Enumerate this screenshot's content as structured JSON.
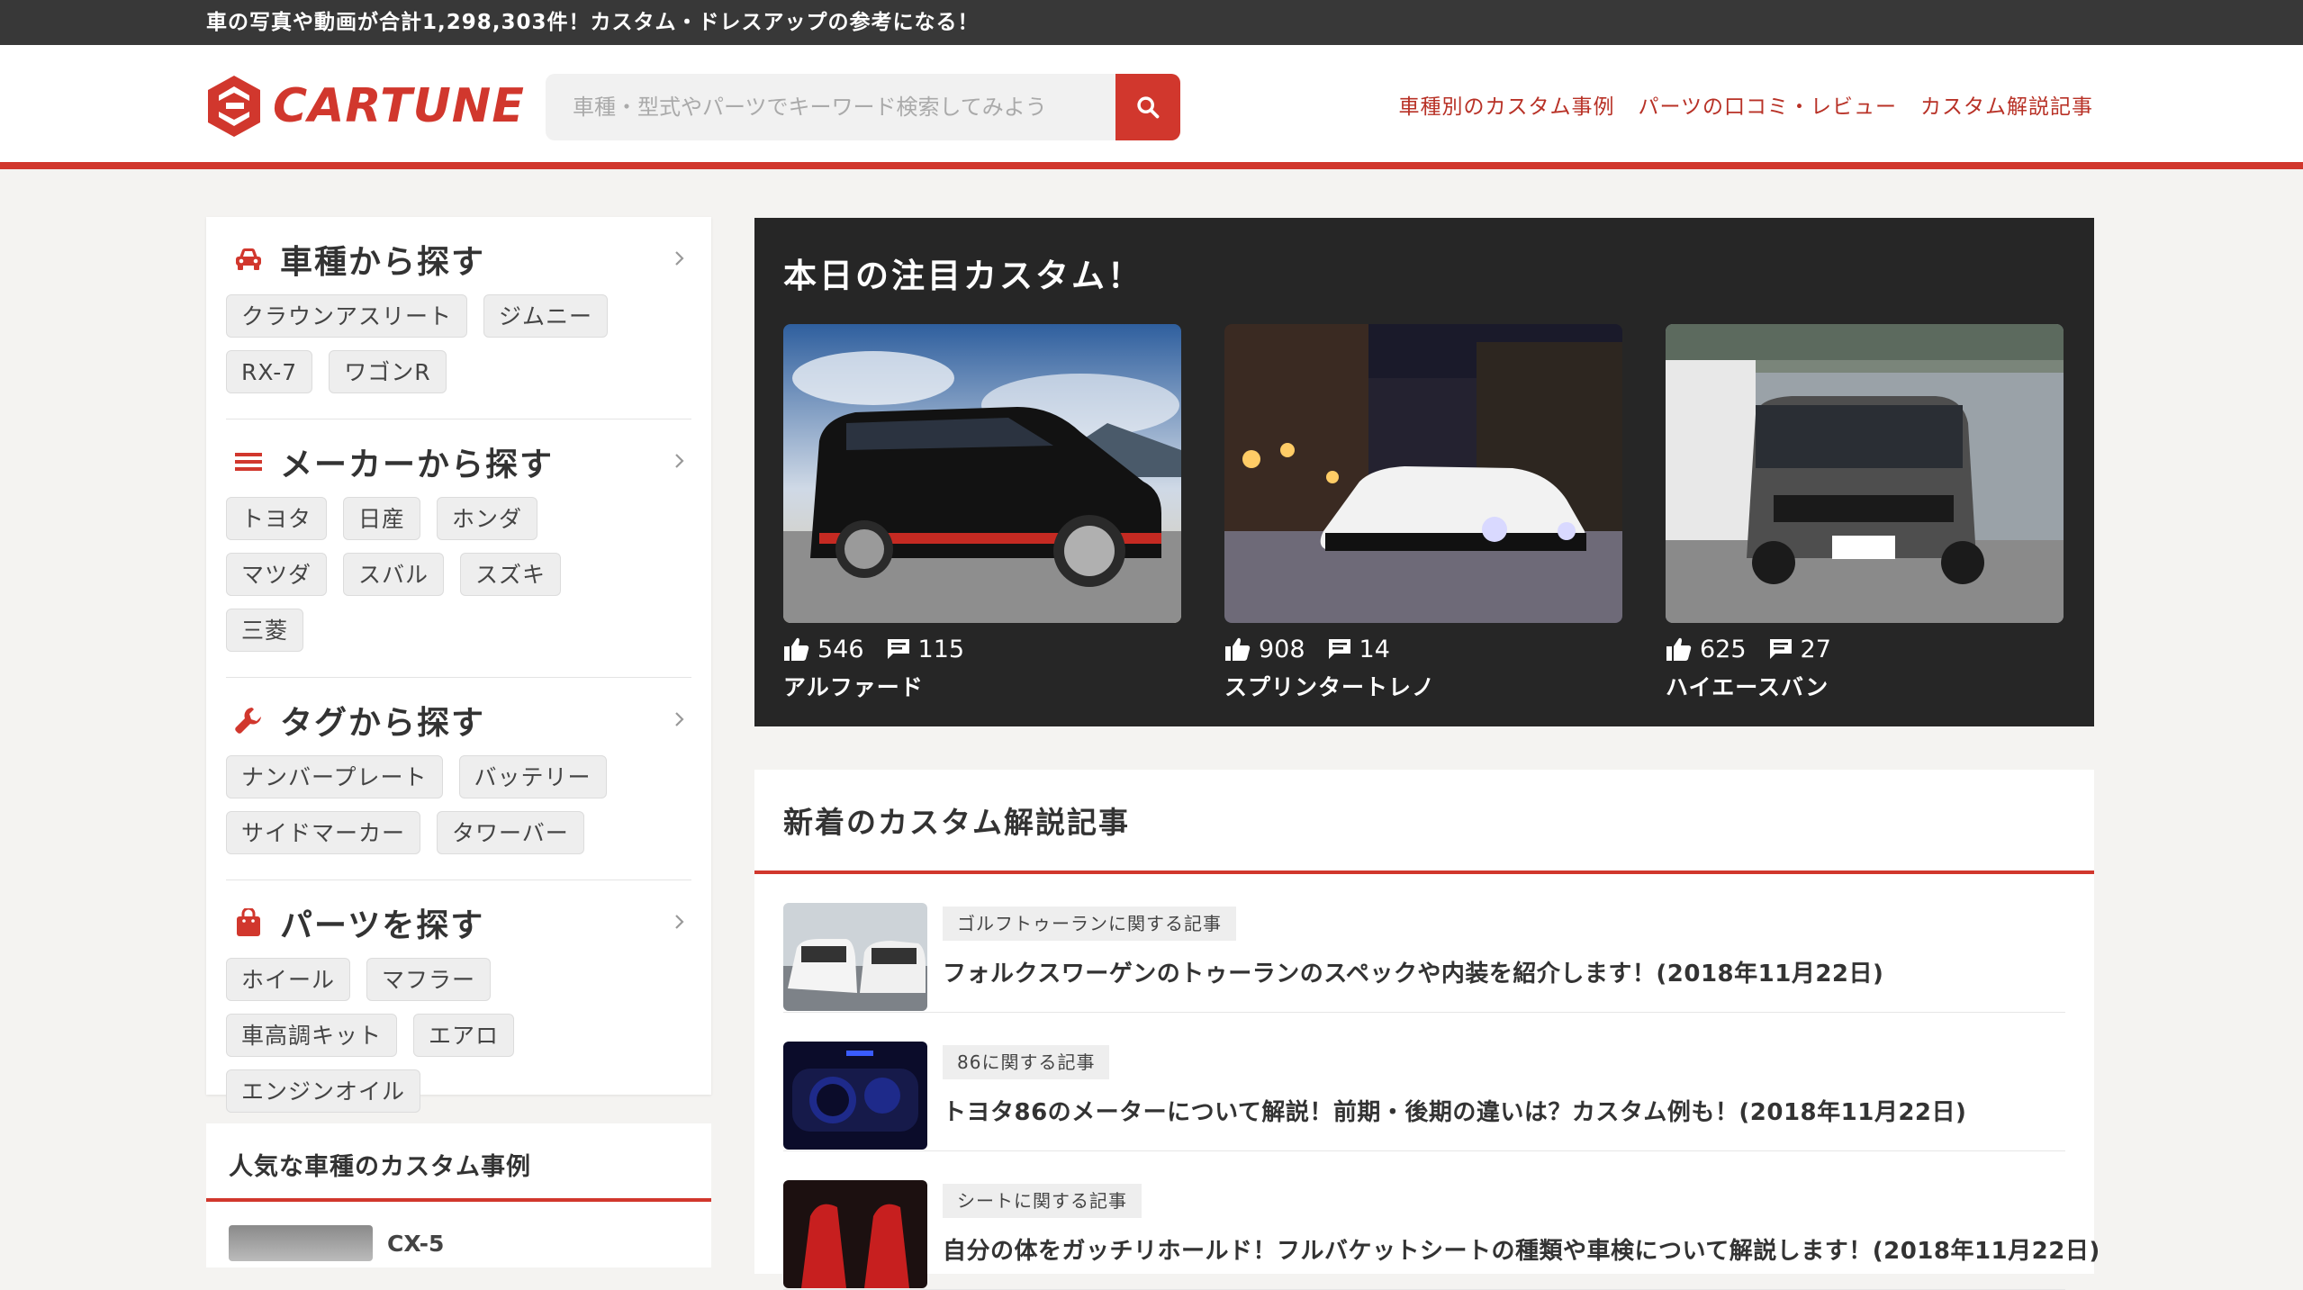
{
  "topbar": {
    "text": "車の写真や動画が合計1,298,303件！カスタム・ドレスアップの参考になる！"
  },
  "header": {
    "logo_text": "CARTUNE",
    "search_placeholder": "車種・型式やパーツでキーワード検索してみよう",
    "nav": [
      "車種別のカスタム事例",
      "パーツの口コミ・レビュー",
      "カスタム解説記事"
    ]
  },
  "sidebar": {
    "sections": [
      {
        "title": "車種から探す",
        "icon": "car-icon",
        "tags": [
          "クラウンアスリート",
          "ジムニー",
          "RX-7",
          "ワゴンR"
        ]
      },
      {
        "title": "メーカーから探す",
        "icon": "menu-icon",
        "tags": [
          "トヨタ",
          "日産",
          "ホンダ",
          "マツダ",
          "スバル",
          "スズキ",
          "三菱"
        ]
      },
      {
        "title": "タグから探す",
        "icon": "wrench-icon",
        "tags": [
          "ナンバープレート",
          "バッテリー",
          "サイドマーカー",
          "タワーバー"
        ]
      },
      {
        "title": "パーツを探す",
        "icon": "bag-icon",
        "tags": [
          "ホイール",
          "マフラー",
          "車高調キット",
          "エアロ",
          "エンジンオイル"
        ]
      }
    ]
  },
  "popular": {
    "title": "人気な車種のカスタム事例",
    "items": [
      {
        "name": "CX-5"
      }
    ]
  },
  "featured": {
    "title": "本日の注目カスタム！",
    "cards": [
      {
        "likes": "546",
        "comments": "115",
        "name": "アルファード"
      },
      {
        "likes": "908",
        "comments": "14",
        "name": "スプリンタートレノ"
      },
      {
        "likes": "625",
        "comments": "27",
        "name": "ハイエースバン"
      }
    ]
  },
  "articles": {
    "title": "新着のカスタム解説記事",
    "items": [
      {
        "tag": "ゴルフトゥーランに関する記事",
        "title": "フォルクスワーゲンのトゥーランのスペックや内装を紹介します！(2018年11月22日)"
      },
      {
        "tag": "86に関する記事",
        "title": "トヨタ86のメーターについて解説！前期・後期の違いは？カスタム例も！(2018年11月22日)"
      },
      {
        "tag": "シートに関する記事",
        "title": "自分の体をガッチリホールド！フルバケットシートの種類や車検について解説します！(2018年11月22日)"
      }
    ]
  },
  "colors": {
    "brand": "#d1372d",
    "topbar": "#383838",
    "featured_bg": "#262626",
    "page_bg": "#f4f3f1"
  }
}
